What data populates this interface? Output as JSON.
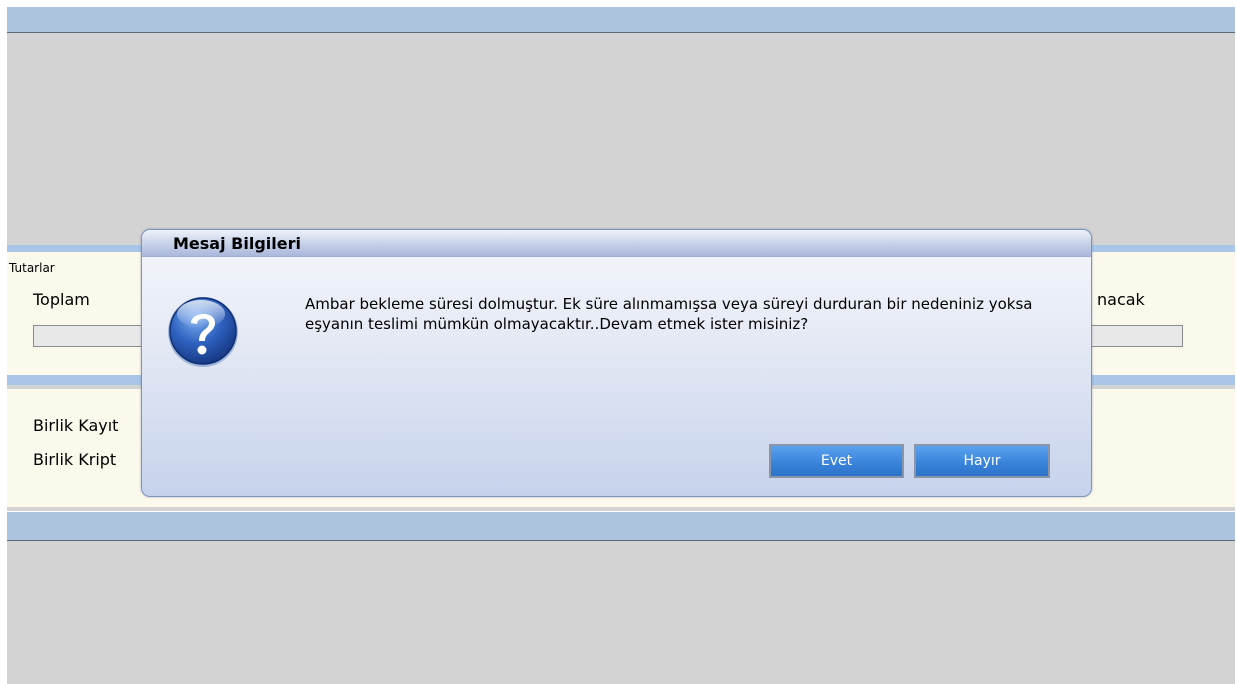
{
  "background": {
    "group_legend": "Tutarlar",
    "total_label": "Toplam",
    "right_label": "nacak",
    "row1_label": "Birlik Kayıt",
    "row2_label": "Birlik Kript"
  },
  "dialog": {
    "title": "Mesaj Bilgileri",
    "icon": "question-icon",
    "message": "Ambar bekleme süresi dolmuştur. Ek süre alınmamışsa veya süreyi durduran bir nedeniniz yoksa eşyanın teslimi mümkün olmayacaktır..Devam etmek ister misiniz?",
    "yes_label": "Evet",
    "no_label": "Hayır"
  },
  "colors": {
    "strip": "#adc4df",
    "panel": "#fbf8ec",
    "button": "#3a84db"
  }
}
